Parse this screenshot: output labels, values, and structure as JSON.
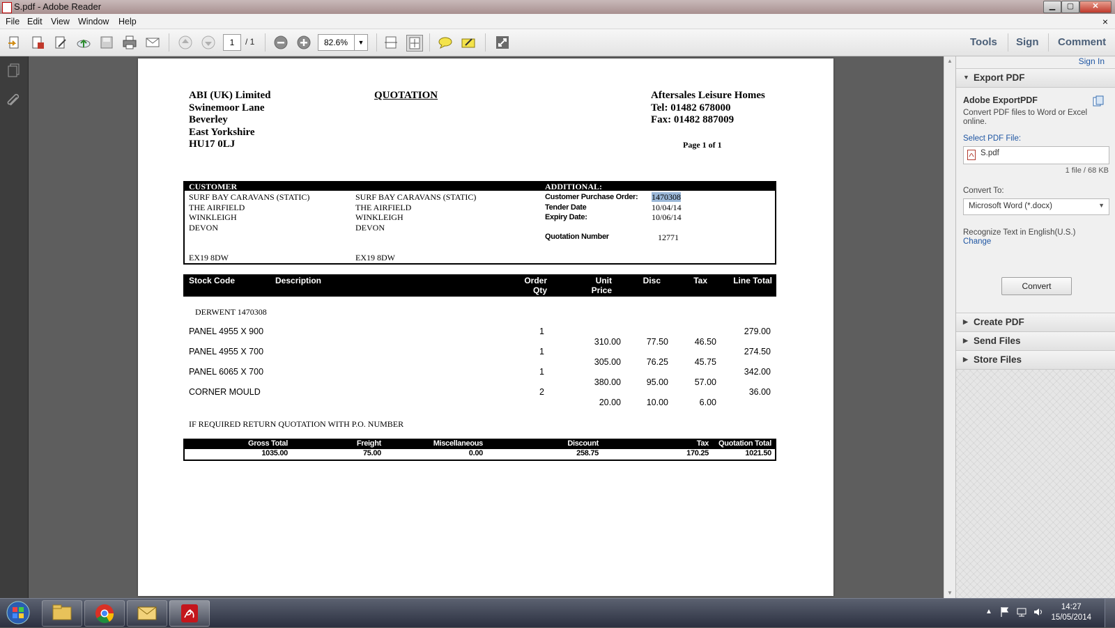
{
  "window": {
    "title": "S.pdf - Adobe Reader",
    "min": "▁",
    "max": "▢",
    "close": "✕"
  },
  "menu": [
    "File",
    "Edit",
    "View",
    "Window",
    "Help"
  ],
  "menu_close": "×",
  "toolbar": {
    "page_current": "1",
    "page_total": "/ 1",
    "zoom": "82.6%",
    "zoom_arrow": "▼",
    "tabs": [
      "Tools",
      "Sign",
      "Comment"
    ]
  },
  "panel": {
    "sign_in": "Sign In",
    "export_pdf": "Export PDF",
    "service_title": "Adobe ExportPDF",
    "service_desc": "Convert PDF files to Word or Excel online.",
    "select_label": "Select PDF File:",
    "file_name": "S.pdf",
    "file_info": "1 file / 68 KB",
    "convert_to_label": "Convert To:",
    "convert_to_value": "Microsoft Word (*.docx)",
    "recognize": "Recognize Text in English(U.S.)",
    "change": "Change",
    "convert_button": "Convert",
    "sections": [
      "Create PDF",
      "Send Files",
      "Store Files"
    ]
  },
  "doc": {
    "company": [
      "ABI (UK) Limited",
      "Swinemoor Lane",
      "Beverley",
      "East Yorkshire",
      "HU17 0LJ"
    ],
    "title": "QUOTATION",
    "supplier": [
      "Aftersales Leisure Homes",
      "Tel: 01482 678000",
      "Fax: 01482 887009"
    ],
    "page_label": "Page 1 of 1",
    "customer_header": "CUSTOMER",
    "additional_header": "ADDITIONAL:",
    "customer_addr1": [
      "SURF BAY CARAVANS (STATIC)",
      "THE AIRFIELD",
      "WINKLEIGH",
      "DEVON"
    ],
    "customer_addr2": [
      "SURF BAY CARAVANS (STATIC)",
      "THE AIRFIELD",
      "WINKLEIGH",
      "DEVON"
    ],
    "postcode1": "EX19 8DW",
    "postcode2": "EX19 8DW",
    "additional": [
      {
        "label": "Customer Purchase Order:",
        "value": "1470308"
      },
      {
        "label": "Tender Date",
        "value": "10/04/14"
      },
      {
        "label": "Expiry Date:",
        "value": "10/06/14"
      },
      {
        "label": "Quotation Number",
        "value": "12771"
      }
    ],
    "columns": [
      "Stock Code",
      "Description",
      "Order Qty",
      "Unit Price",
      "Disc",
      "Tax",
      "Line Total"
    ],
    "reference": "DERWENT 1470308",
    "items": [
      {
        "code": "PANEL 4955 X 900",
        "qty": "1",
        "line_total": "279.00",
        "unit_price": "310.00",
        "disc": "77.50",
        "tax": "46.50"
      },
      {
        "code": "PANEL 4955 X 700",
        "qty": "1",
        "line_total": "274.50",
        "unit_price": "305.00",
        "disc": "76.25",
        "tax": "45.75"
      },
      {
        "code": "PANEL 6065 X 700",
        "qty": "1",
        "line_total": "342.00",
        "unit_price": "380.00",
        "disc": "95.00",
        "tax": "57.00"
      },
      {
        "code": "CORNER MOULD",
        "qty": "2",
        "line_total": "36.00",
        "unit_price": "20.00",
        "disc": "10.00",
        "tax": "6.00"
      }
    ],
    "note": "IF REQUIRED RETURN QUOTATION WITH P.O. NUMBER",
    "totals": [
      {
        "label": "Gross Total",
        "value": "1035.00"
      },
      {
        "label": "Freight",
        "value": "75.00"
      },
      {
        "label": "Miscellaneous",
        "value": "0.00"
      },
      {
        "label": "Discount",
        "value": "258.75"
      },
      {
        "label": "Tax",
        "value": "170.25"
      },
      {
        "label": "Quotation Total",
        "value": "1021.50"
      }
    ]
  },
  "taskbar": {
    "time": "14:27",
    "date": "15/05/2014"
  }
}
